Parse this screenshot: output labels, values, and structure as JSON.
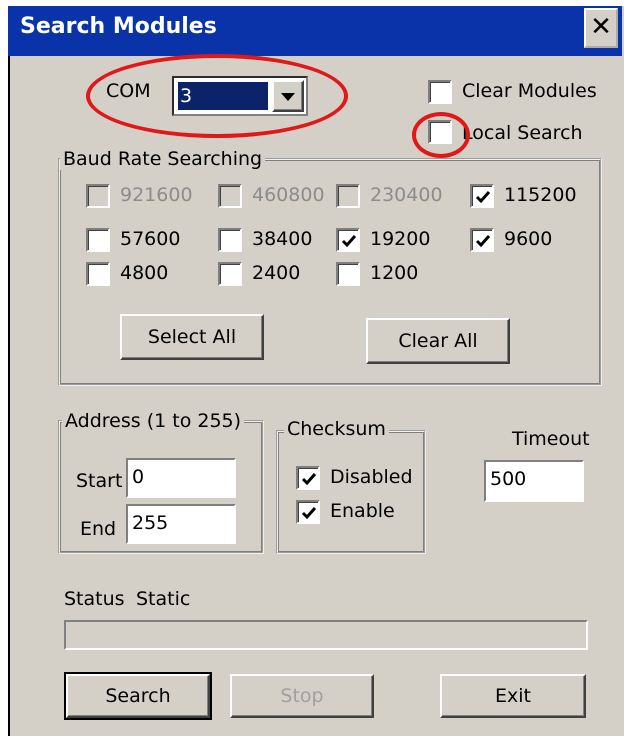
{
  "window": {
    "title": "Search Modules",
    "close_glyph": "✕"
  },
  "com": {
    "label": "COM",
    "value": "3",
    "dropdown_icon": "chevron-down-icon"
  },
  "options": {
    "clear_modules": {
      "label": "Clear Modules",
      "checked": false
    },
    "local_search": {
      "label": "Local Search",
      "checked": false
    }
  },
  "baud": {
    "group_label": "Baud Rate Searching",
    "rates": [
      {
        "label": "921600",
        "checked": false,
        "enabled": false
      },
      {
        "label": "460800",
        "checked": false,
        "enabled": false
      },
      {
        "label": "230400",
        "checked": false,
        "enabled": false
      },
      {
        "label": "115200",
        "checked": true,
        "enabled": true
      },
      {
        "label": "57600",
        "checked": false,
        "enabled": true
      },
      {
        "label": "38400",
        "checked": false,
        "enabled": true
      },
      {
        "label": "19200",
        "checked": true,
        "enabled": true
      },
      {
        "label": "9600",
        "checked": true,
        "enabled": true
      },
      {
        "label": "4800",
        "checked": false,
        "enabled": true
      },
      {
        "label": "2400",
        "checked": false,
        "enabled": true
      },
      {
        "label": "1200",
        "checked": false,
        "enabled": true
      }
    ],
    "select_all": "Select All",
    "clear_all": "Clear All"
  },
  "address": {
    "group_label": "Address (1 to 255)",
    "start_label": "Start",
    "start_value": "0",
    "end_label": "End",
    "end_value": "255"
  },
  "checksum": {
    "group_label": "Checksum",
    "disabled": {
      "label": "Disabled",
      "checked": true
    },
    "enable": {
      "label": "Enable",
      "checked": true
    }
  },
  "timeout": {
    "label": "Timeout",
    "value": "500"
  },
  "status": {
    "label": "Status",
    "text": "Static",
    "progress": 0
  },
  "buttons": {
    "search": "Search",
    "stop": "Stop",
    "exit": "Exit"
  },
  "annotation_color": "#e01818"
}
